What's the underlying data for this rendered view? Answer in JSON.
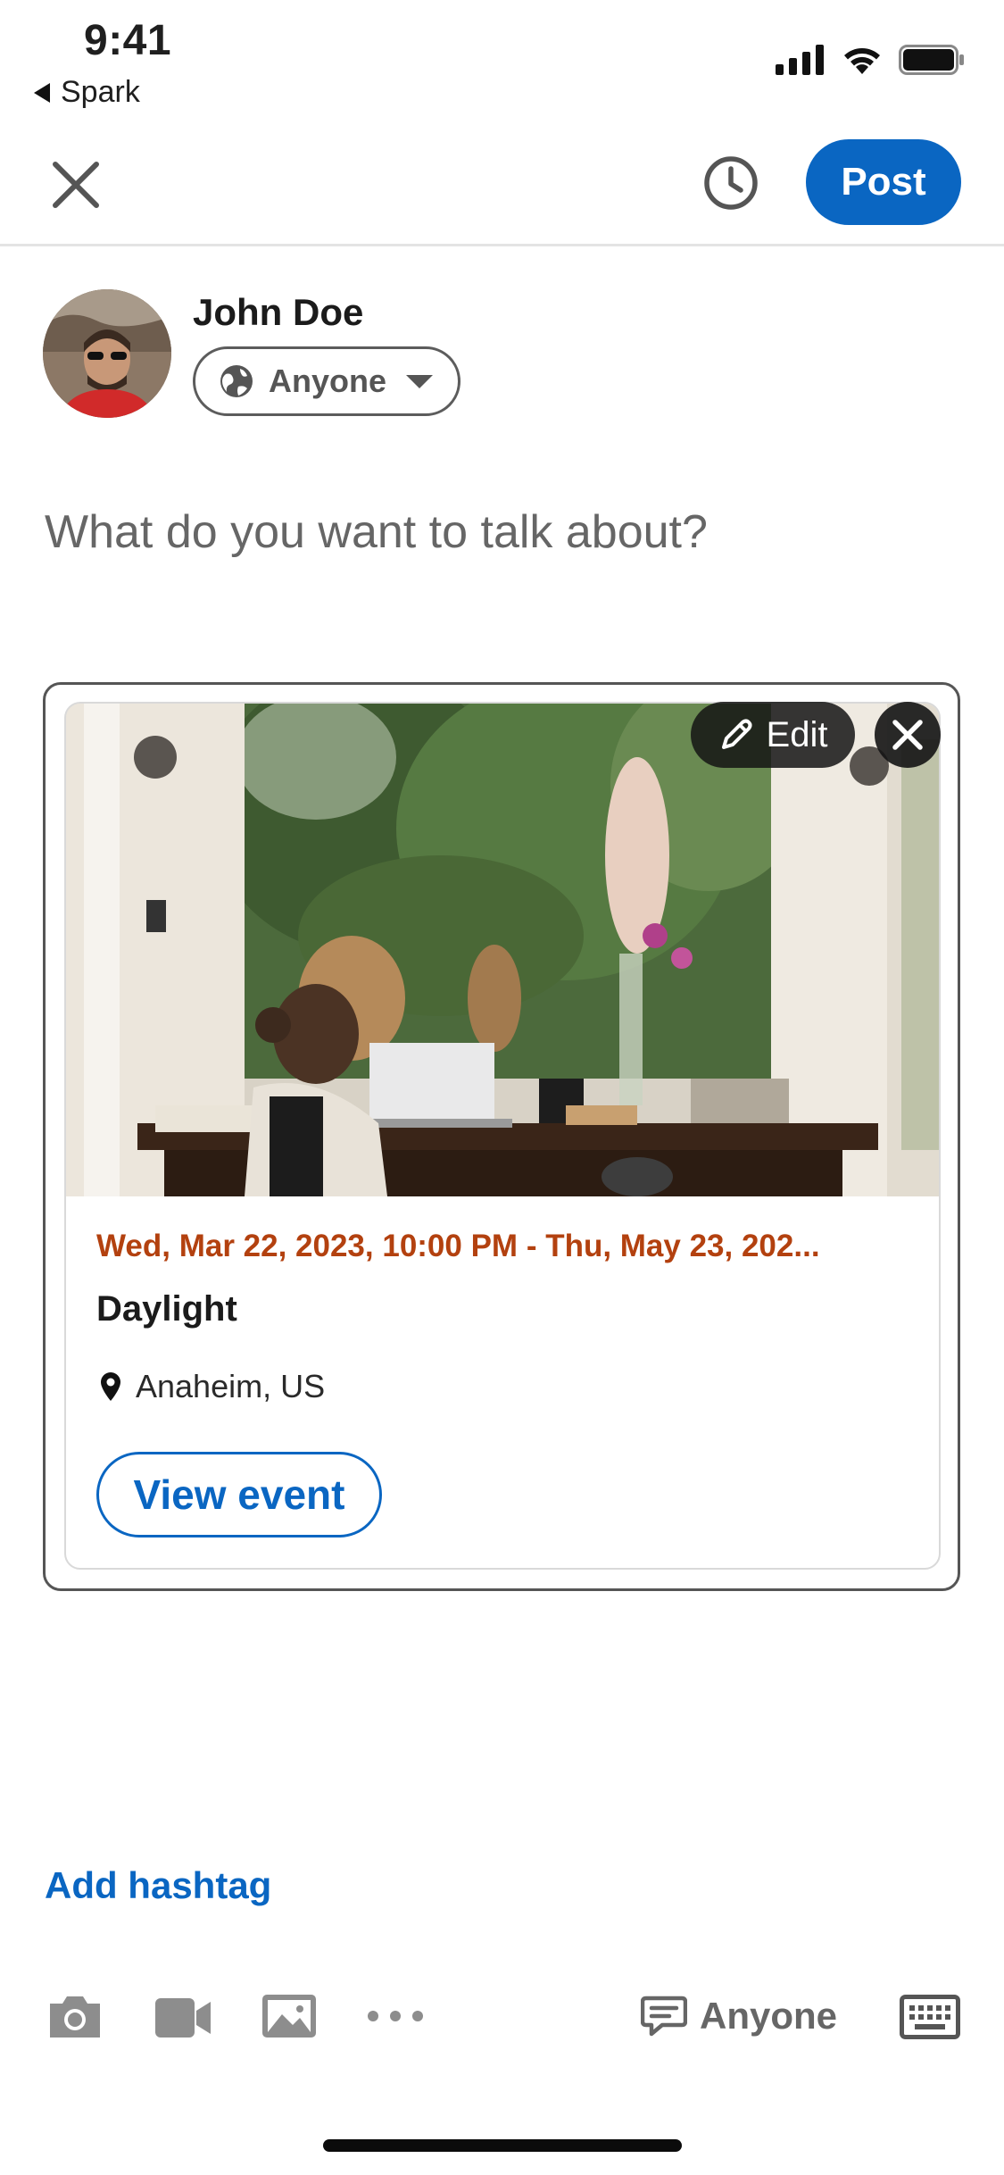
{
  "status_bar": {
    "time": "9:41",
    "back_app": "Spark"
  },
  "header": {
    "close_icon": "close-icon",
    "schedule_icon": "clock-icon",
    "post_label": "Post"
  },
  "author": {
    "name": "John Doe",
    "audience": "Anyone"
  },
  "composer": {
    "placeholder": "What do you want to talk about?"
  },
  "event": {
    "date_range": "Wed, Mar 22, 2023, 10:00 PM - Thu, May 23, 202...",
    "title": "Daylight",
    "location": "Anaheim, US",
    "view_label": "View event",
    "edit_label": "Edit"
  },
  "add_hashtag": "Add hashtag",
  "toolbar": {
    "icons": [
      "camera-icon",
      "video-icon",
      "photo-icon",
      "more-icon"
    ],
    "comment_audience": "Anyone"
  },
  "colors": {
    "accent": "#0a66c2",
    "event_date": "#b3410f"
  }
}
